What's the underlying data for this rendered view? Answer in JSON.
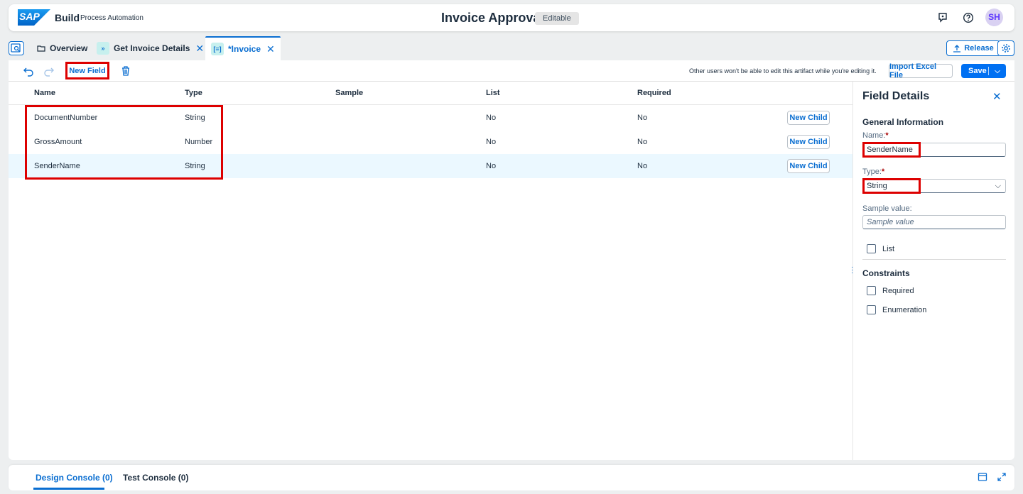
{
  "shell": {
    "logo_text": "SAP",
    "brand": "Build",
    "brand_sub": "Process Automation",
    "title": "Invoice Approval",
    "badge": "Editable",
    "avatar": "SH"
  },
  "tabs": [
    {
      "label": "Overview",
      "icon": "folder-icon"
    },
    {
      "label": "Get Invoice Details",
      "icon": "chevrons-icon",
      "closable": true
    },
    {
      "label": "*Invoice",
      "icon": "datatype-icon",
      "closable": true,
      "active": true
    }
  ],
  "tabbar": {
    "release_label": "Release"
  },
  "toolbar": {
    "new_field_label": "New Field",
    "lock_note": "Other users won't be able to edit this artifact while you're editing it.",
    "import_label": "Import Excel File",
    "save_label": "Save"
  },
  "table": {
    "headers": [
      "Name",
      "Type",
      "Sample",
      "List",
      "Required"
    ],
    "new_child_label": "New Child",
    "rows": [
      {
        "name": "DocumentNumber",
        "type": "String",
        "sample": "",
        "list": "No",
        "required": "No"
      },
      {
        "name": "GrossAmount",
        "type": "Number",
        "sample": "",
        "list": "No",
        "required": "No"
      },
      {
        "name": "SenderName",
        "type": "String",
        "sample": "",
        "list": "No",
        "required": "No",
        "selected": true
      }
    ]
  },
  "details": {
    "title": "Field Details",
    "general_heading": "General Information",
    "name_label": "Name:",
    "name_value": "SenderName",
    "type_label": "Type:",
    "type_value": "String",
    "sample_label": "Sample value:",
    "sample_placeholder": "Sample value",
    "list_label": "List",
    "constraints_heading": "Constraints",
    "required_label": "Required",
    "enumeration_label": "Enumeration",
    "required_marker": "*"
  },
  "console": {
    "design_tab": "Design Console (0)",
    "test_tab": "Test Console (0)"
  },
  "colors": {
    "accent": "#0a6ed1",
    "highlight": "#dd0000",
    "selected_row": "#ebf8ff"
  }
}
